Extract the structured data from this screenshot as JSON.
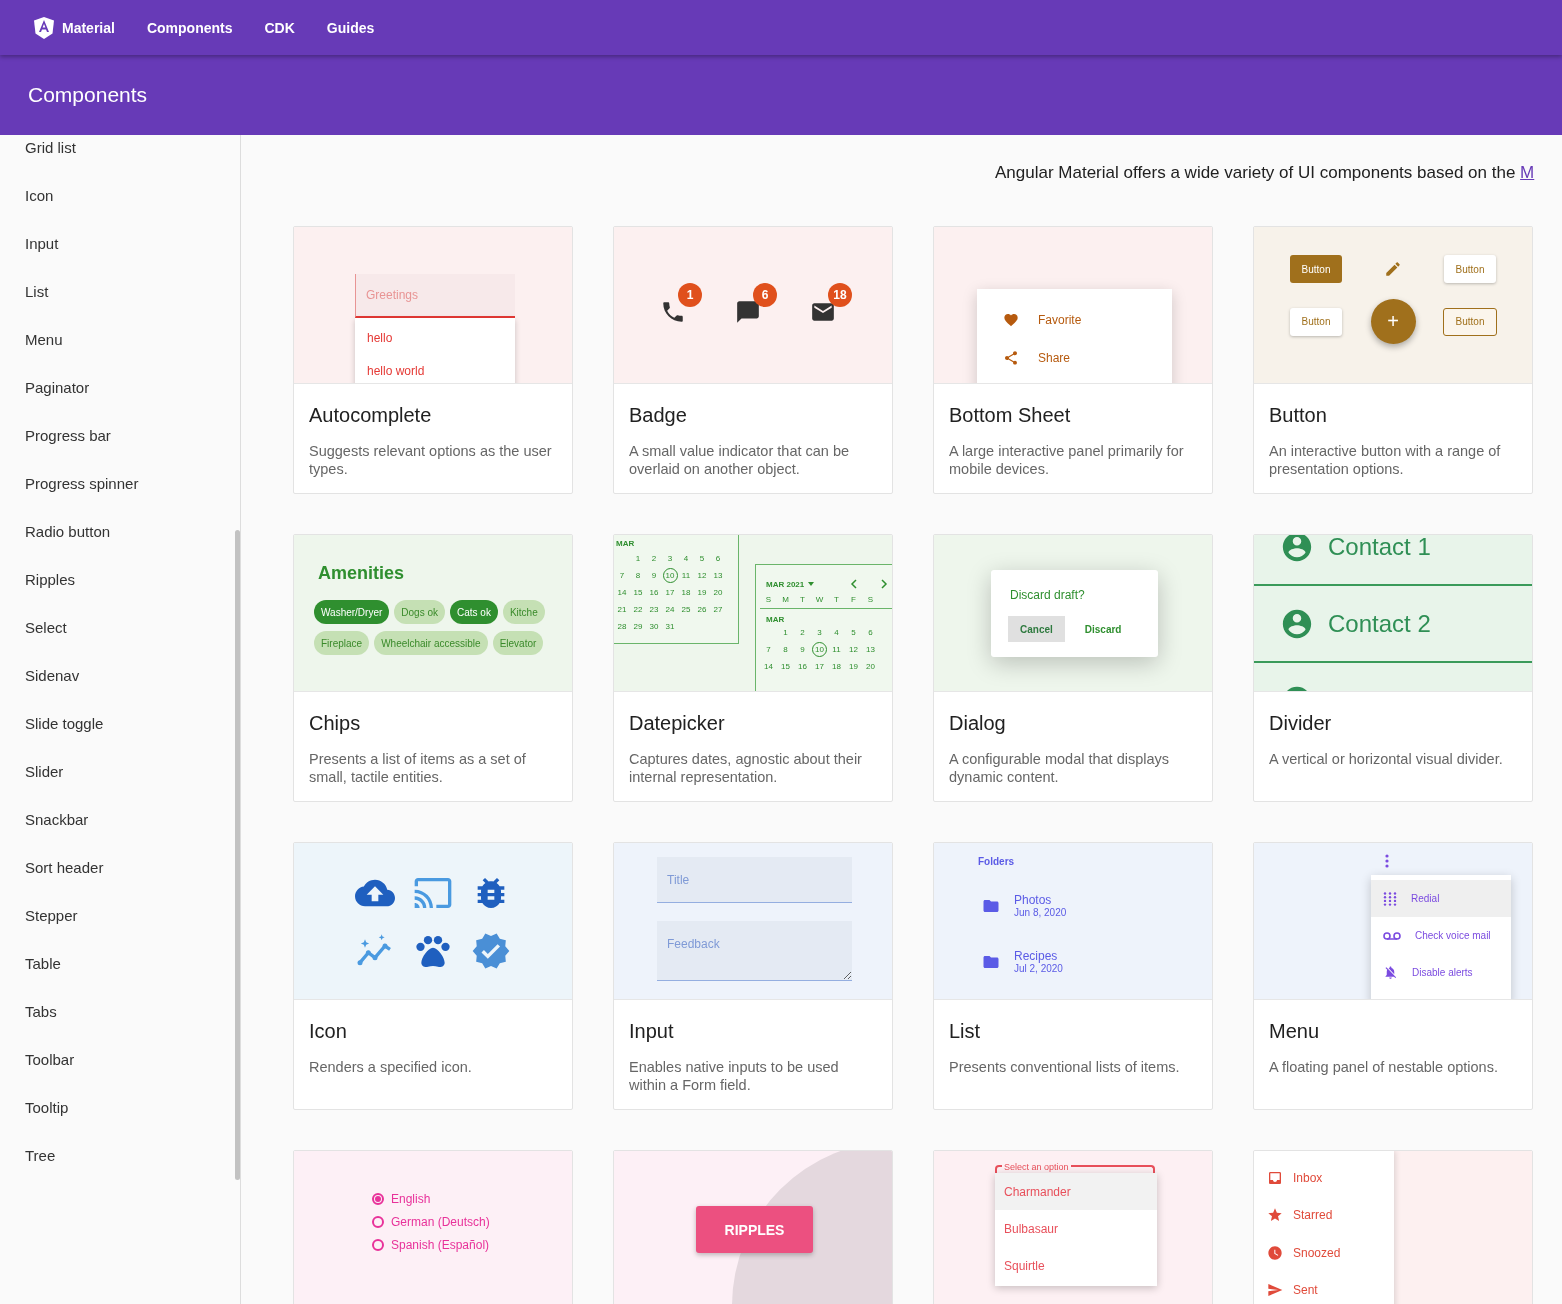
{
  "nav": {
    "brand": "Material",
    "links": [
      "Components",
      "CDK",
      "Guides"
    ]
  },
  "header": {
    "title": "Components"
  },
  "sidebar": {
    "items": [
      "Grid list",
      "Icon",
      "Input",
      "List",
      "Menu",
      "Paginator",
      "Progress bar",
      "Progress spinner",
      "Radio button",
      "Ripples",
      "Select",
      "Sidenav",
      "Slide toggle",
      "Slider",
      "Snackbar",
      "Sort header",
      "Stepper",
      "Table",
      "Tabs",
      "Toolbar",
      "Tooltip",
      "Tree"
    ]
  },
  "intro": {
    "text": "Angular Material offers a wide variety of UI components based on the",
    "link": "M"
  },
  "cards": [
    {
      "kind": "autocomplete",
      "title": "Autocomplete",
      "description": "Suggests relevant options as the user types.",
      "preview": {
        "placeholder": "Greetings",
        "options": [
          "hello",
          "hello world"
        ]
      }
    },
    {
      "kind": "badge",
      "title": "Badge",
      "description": "A small value indicator that can be overlaid on another object.",
      "preview": {
        "badges": [
          "1",
          "6",
          "18"
        ]
      }
    },
    {
      "kind": "bottom_sheet",
      "title": "Bottom Sheet",
      "description": "A large interactive panel primarily for mobile devices.",
      "preview": {
        "items": [
          "Favorite",
          "Share"
        ]
      }
    },
    {
      "kind": "button",
      "title": "Button",
      "description": "An interactive button with a range of presentation options.",
      "preview": {
        "buttons": [
          "Button",
          "Button",
          "Button",
          "Button"
        ],
        "fab": "+"
      }
    },
    {
      "kind": "chips",
      "title": "Chips",
      "description": "Presents a list of items as a set of small, tactile entities.",
      "preview": {
        "heading": "Amenities",
        "chips": [
          {
            "label": "Washer/Dryer",
            "selected": true
          },
          {
            "label": "Dogs ok",
            "selected": false
          },
          {
            "label": "Cats ok",
            "selected": true
          },
          {
            "label": "Kitche",
            "selected": false
          },
          {
            "label": "Fireplace",
            "selected": false
          },
          {
            "label": "Wheelchair accessible",
            "selected": false
          },
          {
            "label": "Elevator",
            "selected": false
          }
        ]
      }
    },
    {
      "kind": "datepicker",
      "title": "Datepicker",
      "description": "Captures dates, agnostic about their internal representation.",
      "preview": {
        "left": {
          "month": "MAR",
          "weeks": [
            [
              "1",
              "2",
              "3",
              "4",
              "5",
              "6"
            ],
            [
              "7",
              "8",
              "9",
              {
                "day": "10",
                "circled": true
              },
              "11",
              "12",
              "13"
            ],
            [
              "14",
              "15",
              "16",
              "17",
              "18",
              "19",
              "20"
            ],
            [
              "21",
              "22",
              "23",
              "24",
              "25",
              "26",
              "27"
            ],
            [
              "28",
              "29",
              "30",
              "31"
            ]
          ]
        },
        "right": {
          "period": "MAR 2021",
          "weekdays": [
            "S",
            "M",
            "T",
            "W",
            "T",
            "F",
            "S"
          ],
          "month": "MAR",
          "weeks": [
            [
              "1",
              "2",
              "3",
              "4",
              "5",
              "6"
            ],
            [
              "7",
              "8",
              "9",
              {
                "day": "10",
                "circled": true
              },
              "11",
              "12",
              "13"
            ],
            [
              "14",
              "15",
              "16",
              "17",
              "18",
              "19",
              "20"
            ]
          ]
        }
      }
    },
    {
      "kind": "dialog",
      "title": "Dialog",
      "description": "A configurable modal that displays dynamic content.",
      "preview": {
        "heading": "Discard draft?",
        "buttons": [
          "Cancel",
          "Discard"
        ]
      }
    },
    {
      "kind": "divider",
      "title": "Divider",
      "description": "A vertical or horizontal visual divider.",
      "preview": {
        "contacts": [
          "Contact 1",
          "Contact 2"
        ]
      }
    },
    {
      "kind": "icon",
      "title": "Icon",
      "description": "Renders a specified icon."
    },
    {
      "kind": "input",
      "title": "Input",
      "description": "Enables native inputs to be used within a Form field.",
      "preview": {
        "placeholders": [
          "Title",
          "Feedback"
        ]
      }
    },
    {
      "kind": "list",
      "title": "List",
      "description": "Presents conventional lists of items.",
      "preview": {
        "heading": "Folders",
        "items": [
          {
            "name": "Photos",
            "date": "Jun 8, 2020"
          },
          {
            "name": "Recipes",
            "date": "Jul 2, 2020"
          }
        ]
      }
    },
    {
      "kind": "menu",
      "title": "Menu",
      "description": "A floating panel of nestable options.",
      "preview": {
        "items": [
          "Redial",
          "Check voice mail",
          "Disable alerts"
        ]
      }
    },
    {
      "kind": "radio",
      "preview": {
        "options": [
          {
            "label": "English",
            "selected": true
          },
          {
            "label": "German (Deutsch)",
            "selected": false
          },
          {
            "label": "Spanish (Español)",
            "selected": false
          }
        ]
      }
    },
    {
      "kind": "ripples",
      "preview": {
        "button": "RIPPLES"
      }
    },
    {
      "kind": "select",
      "preview": {
        "label": "Select an option",
        "options": [
          {
            "label": "Charmander",
            "selected": true
          },
          {
            "label": "Bulbasaur",
            "selected": false
          },
          {
            "label": "Squirtle",
            "selected": false
          }
        ]
      }
    },
    {
      "kind": "sidenav",
      "preview": {
        "items": [
          "Inbox",
          "Starred",
          "Snoozed",
          "Sent"
        ]
      }
    }
  ]
}
